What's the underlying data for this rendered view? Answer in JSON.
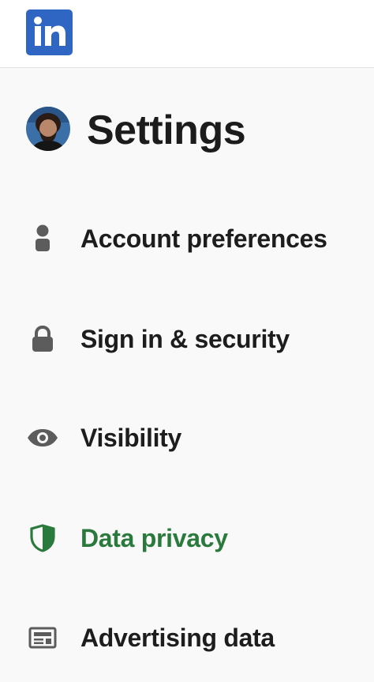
{
  "app": {
    "logo_icon": "linkedin-logo",
    "brand_color": "#2f66c4"
  },
  "header": {
    "title": "Settings",
    "avatar_icon": "user-avatar"
  },
  "menu": {
    "active_color": "#2b7a3d",
    "items": [
      {
        "label": "Account preferences",
        "icon": "person-icon",
        "active": false
      },
      {
        "label": "Sign in & security",
        "icon": "lock-icon",
        "active": false
      },
      {
        "label": "Visibility",
        "icon": "eye-icon",
        "active": false
      },
      {
        "label": "Data privacy",
        "icon": "shield-icon",
        "active": true
      },
      {
        "label": "Advertising data",
        "icon": "newspaper-icon",
        "active": false
      }
    ]
  }
}
